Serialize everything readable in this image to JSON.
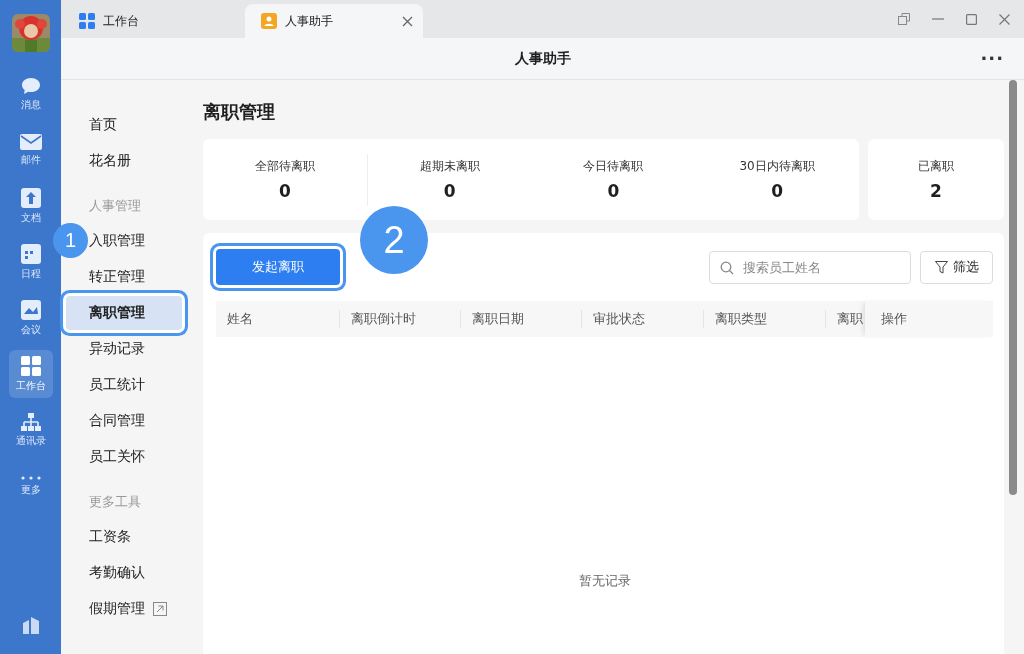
{
  "rail": {
    "items": [
      {
        "kind": "chat",
        "label": "消息",
        "selected": false
      },
      {
        "kind": "mail",
        "label": "邮件",
        "selected": false
      },
      {
        "kind": "doc",
        "label": "文档",
        "selected": false
      },
      {
        "kind": "calendar",
        "label": "日程",
        "selected": false
      },
      {
        "kind": "meeting",
        "label": "会议",
        "selected": false
      },
      {
        "kind": "grid",
        "label": "工作台",
        "selected": true
      },
      {
        "kind": "org",
        "label": "通讯录",
        "selected": false
      },
      {
        "kind": "more",
        "label": "更多",
        "selected": false
      }
    ]
  },
  "tabs": [
    {
      "kind": "grid",
      "label": "工作台",
      "selected": false
    },
    {
      "kind": "person",
      "label": "人事助手",
      "selected": true
    }
  ],
  "header": {
    "title": "人事助手",
    "menu": "···"
  },
  "nav": {
    "items": [
      {
        "kind": "item",
        "label": "首页",
        "selected": false
      },
      {
        "kind": "item",
        "label": "花名册",
        "selected": false
      },
      {
        "kind": "group",
        "label": "人事管理"
      },
      {
        "kind": "item",
        "label": "入职管理",
        "selected": false
      },
      {
        "kind": "item",
        "label": "转正管理",
        "selected": false
      },
      {
        "kind": "item",
        "label": "离职管理",
        "selected": true
      },
      {
        "kind": "item",
        "label": "异动记录",
        "selected": false
      },
      {
        "kind": "item",
        "label": "员工统计",
        "selected": false
      },
      {
        "kind": "item",
        "label": "合同管理",
        "selected": false
      },
      {
        "kind": "item",
        "label": "员工关怀",
        "selected": false
      },
      {
        "kind": "group",
        "label": "更多工具"
      },
      {
        "kind": "item",
        "label": "工资条",
        "selected": false
      },
      {
        "kind": "item",
        "label": "考勤确认",
        "selected": false
      },
      {
        "kind": "external",
        "label": "假期管理",
        "selected": false
      }
    ]
  },
  "page_title": "离职管理",
  "stats": [
    {
      "label": "全部待离职",
      "value": "0"
    },
    {
      "label": "超期未离职",
      "value": "0"
    },
    {
      "label": "今日待离职",
      "value": "0"
    },
    {
      "label": "30日内待离职",
      "value": "0"
    }
  ],
  "stat_done": {
    "label": "已离职",
    "value": "2"
  },
  "start_button": "发起离职",
  "search": {
    "placeholder": "搜索员工姓名"
  },
  "filter_button": "筛选",
  "table": {
    "columns": [
      "姓名",
      "离职倒计时",
      "离职日期",
      "审批状态",
      "离职类型",
      "离职"
    ],
    "action_column": "操作",
    "empty": "暂无记录"
  },
  "callouts": [
    "1",
    "2"
  ]
}
